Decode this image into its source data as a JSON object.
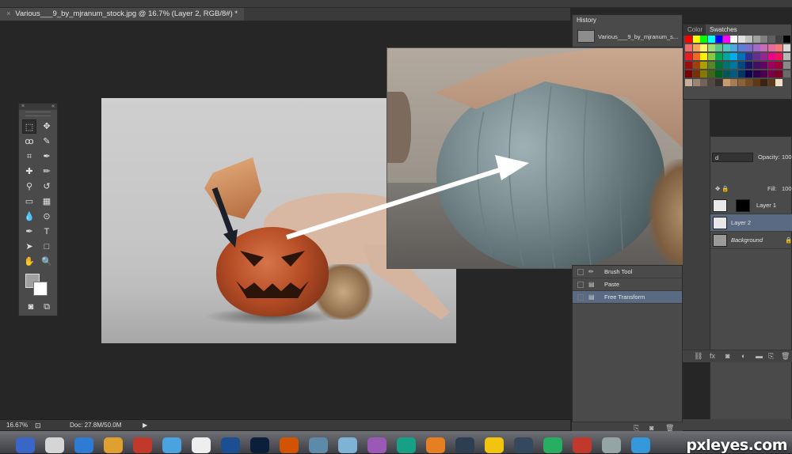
{
  "document": {
    "tab_title": "Various___9_by_mjranum_stock.jpg @ 16.7% (Layer 2, RGB/8#) *",
    "close_glyph": "×"
  },
  "tools": {
    "collapse_left": "×",
    "collapse_right": "«",
    "items": [
      {
        "name": "marquee-tool-icon",
        "glyph": "⬚"
      },
      {
        "name": "move-tool-icon",
        "glyph": "✥"
      },
      {
        "name": "lasso-tool-icon",
        "glyph": "ꝏ"
      },
      {
        "name": "quick-select-tool-icon",
        "glyph": "✎"
      },
      {
        "name": "crop-tool-icon",
        "glyph": "⌗"
      },
      {
        "name": "eyedropper-tool-icon",
        "glyph": "✒"
      },
      {
        "name": "healing-tool-icon",
        "glyph": "✚"
      },
      {
        "name": "brush-tool-icon",
        "glyph": "✏"
      },
      {
        "name": "stamp-tool-icon",
        "glyph": "⚲"
      },
      {
        "name": "history-brush-icon",
        "glyph": "↺"
      },
      {
        "name": "eraser-tool-icon",
        "glyph": "▭"
      },
      {
        "name": "gradient-tool-icon",
        "glyph": "▦"
      },
      {
        "name": "blur-tool-icon",
        "glyph": "💧"
      },
      {
        "name": "dodge-tool-icon",
        "glyph": "⊙"
      },
      {
        "name": "pen-tool-icon",
        "glyph": "✒"
      },
      {
        "name": "type-tool-icon",
        "glyph": "T"
      },
      {
        "name": "path-select-icon",
        "glyph": "➤"
      },
      {
        "name": "shape-tool-icon",
        "glyph": "□"
      },
      {
        "name": "hand-tool-icon",
        "glyph": "✋"
      },
      {
        "name": "zoom-tool-icon",
        "glyph": "🔍"
      }
    ]
  },
  "history": {
    "tab_label": "History",
    "snapshot_label": "Various___9_by_mjranum_s...",
    "steps": [
      {
        "label": "Brush Tool",
        "icon": "brush-icon",
        "glyph": "✏"
      },
      {
        "label": "Paste",
        "icon": "document-icon",
        "glyph": "▤"
      },
      {
        "label": "Free Transform",
        "icon": "document-icon",
        "glyph": "▤"
      }
    ],
    "footer_icons": [
      {
        "name": "new-document-from-state-icon",
        "glyph": "⎘"
      },
      {
        "name": "snapshot-icon",
        "glyph": "◙"
      },
      {
        "name": "trash-icon",
        "glyph": "🗑"
      }
    ]
  },
  "swatches": {
    "tab_color": "Color",
    "tab_swatches": "Swatches",
    "rows": [
      [
        "#ff0000",
        "#ffff00",
        "#00ff00",
        "#00ffff",
        "#0000ff",
        "#ff00ff",
        "#ffffff",
        "#e0e0e0",
        "#c0c0c0",
        "#a0a0a0",
        "#808080",
        "#606060",
        "#404040",
        "#000000"
      ],
      [
        "#f26c6c",
        "#f7a45c",
        "#fff568",
        "#a3d977",
        "#5ec48a",
        "#4fc6c1",
        "#4fa7e0",
        "#5b7ed9",
        "#7b6fd0",
        "#a16bc9",
        "#c86cb9",
        "#e56c9a",
        "#f07a7a",
        "#d8d8d8"
      ],
      [
        "#ed1c24",
        "#f26522",
        "#fff200",
        "#8dc63f",
        "#00a651",
        "#00a99d",
        "#00aeef",
        "#0072bc",
        "#2e3192",
        "#662d91",
        "#92278f",
        "#ec008c",
        "#ed145b",
        "#b7b7b7"
      ],
      [
        "#9e0b0f",
        "#a0410d",
        "#aba000",
        "#598527",
        "#007236",
        "#00746b",
        "#0076a3",
        "#004a80",
        "#1b1464",
        "#440e62",
        "#630460",
        "#9e005d",
        "#9e0039",
        "#898989"
      ],
      [
        "#790000",
        "#7b2e00",
        "#827b00",
        "#406618",
        "#005e20",
        "#005952",
        "#005b7f",
        "#003663",
        "#0d004c",
        "#32004b",
        "#4b0049",
        "#7b0046",
        "#7a0026",
        "#6a6a6a"
      ],
      [
        "#c7b299",
        "#998675",
        "#736357",
        "#534741",
        "#37302d",
        "#c69c6d",
        "#a67c52",
        "#8c6239",
        "#754c24",
        "#603913",
        "#3c2415",
        "#5b3a1b",
        "#efe0c7",
        "#4a4a4a"
      ]
    ]
  },
  "layers": {
    "blend_mode": "d",
    "opacity_label": "Opacity:",
    "opacity_value": "100",
    "fill_label": "Fill:",
    "fill_value": "100",
    "items": [
      {
        "name": "Layer 1",
        "active": false
      },
      {
        "name": "Layer 2",
        "active": true
      },
      {
        "name": "Background",
        "active": false
      }
    ],
    "footer_icons": [
      {
        "name": "link-layers-icon",
        "glyph": "⛓"
      },
      {
        "name": "fx-icon",
        "glyph": "fx"
      },
      {
        "name": "layer-mask-icon",
        "glyph": "◙"
      },
      {
        "name": "adjustment-layer-icon",
        "glyph": "◐"
      },
      {
        "name": "new-group-icon",
        "glyph": "▬"
      },
      {
        "name": "new-layer-icon",
        "glyph": "⎘"
      },
      {
        "name": "delete-layer-icon",
        "glyph": "🗑"
      }
    ]
  },
  "status": {
    "zoom": "16.67%",
    "doc_info": "Doc: 27.8M/50.0M"
  },
  "watermark": "pxleyes.com",
  "colors": {
    "panel_bg": "#4a4a4a",
    "app_bg": "#262626",
    "selection": "#5a6a82",
    "arrow": "#ffffff",
    "arrow_dark": "#1a1f2a"
  }
}
